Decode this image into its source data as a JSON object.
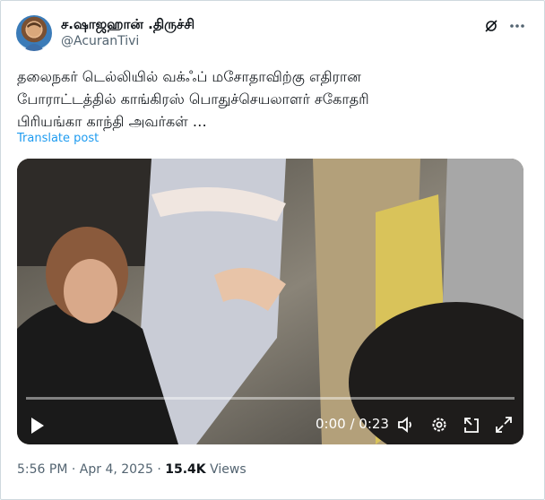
{
  "author": {
    "display_name": "ச.ஷாஜஹான் .திருச்சி",
    "handle": "@AcuranTivi"
  },
  "tweet": {
    "text": "தலைநகர் டெல்லியில் வக்ஃப் மசோதாவிற்கு எதிரான\nபோராட்டத்தில் காங்கிரஸ் பொதுச்செயலாளர் சகோதரி\nபிரியங்கா காந்தி அவர்கள் …",
    "translate_label": "Translate post"
  },
  "video": {
    "time_display": "0:00 / 0:23",
    "progress_fraction": 0.0,
    "controls": [
      "play-icon",
      "volume-icon",
      "settings-icon",
      "pip-icon",
      "fullscreen-icon"
    ]
  },
  "meta": {
    "time": "5:56 PM",
    "separator": "·",
    "date": "Apr 4, 2025",
    "views_count": "15.4K",
    "views_label": "Views"
  },
  "colors": {
    "accent": "#1d9bf0",
    "text_secondary": "#536471",
    "border": "#cfd9de"
  },
  "icons": [
    "grok-icon",
    "more-icon"
  ]
}
